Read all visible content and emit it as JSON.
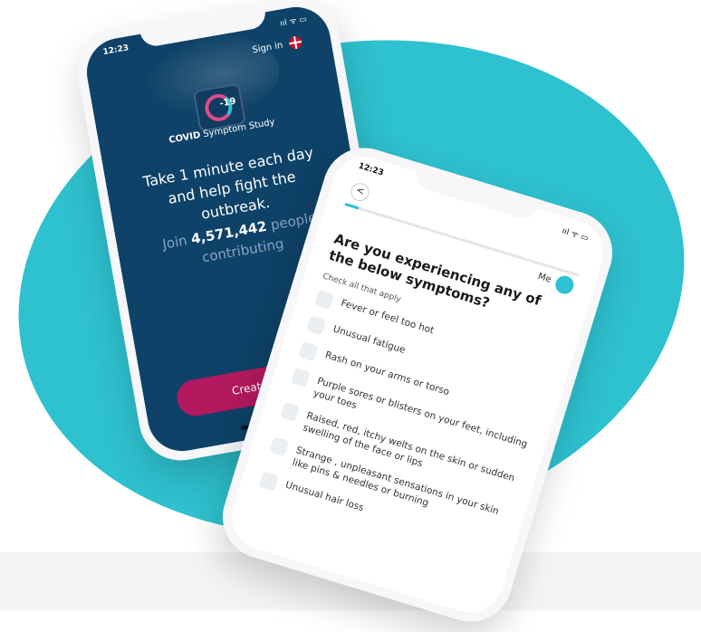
{
  "colors": {
    "accent": "#2ec1cf",
    "navy": "#0e4268",
    "magenta": "#b3195e"
  },
  "left_phone": {
    "time": "12:23",
    "status_icons": "ııl ᯤ ▭",
    "sign_in": "Sign in",
    "logo_number": "-19",
    "app_name_bold": "COVID",
    "app_name_rest": "Symptom Study",
    "tagline": "Take 1 minute each day and help fight the outbreak.",
    "join_prefix": "Join",
    "join_count": "4,571,442",
    "join_suffix": "people contributing",
    "create_account": "Create account"
  },
  "right_phone": {
    "time": "12:23",
    "status_icons": "ııl ᯤ ▭",
    "back": "<",
    "me": "Me",
    "progress": 0.06,
    "question": "Are you experiencing any of the below symptoms?",
    "hint": "Check all that apply",
    "options": [
      "Fever or feel too hot",
      "Unusual fatigue",
      "Rash on your arms or torso",
      "Purple sores or blisters on your feet, including your toes",
      "Raised, red, itchy welts on the skin or sudden swelling of the face or lips",
      "Strange , unpleasant sensations in your skin like pins & needles or burning",
      "Unusual hair loss"
    ]
  }
}
